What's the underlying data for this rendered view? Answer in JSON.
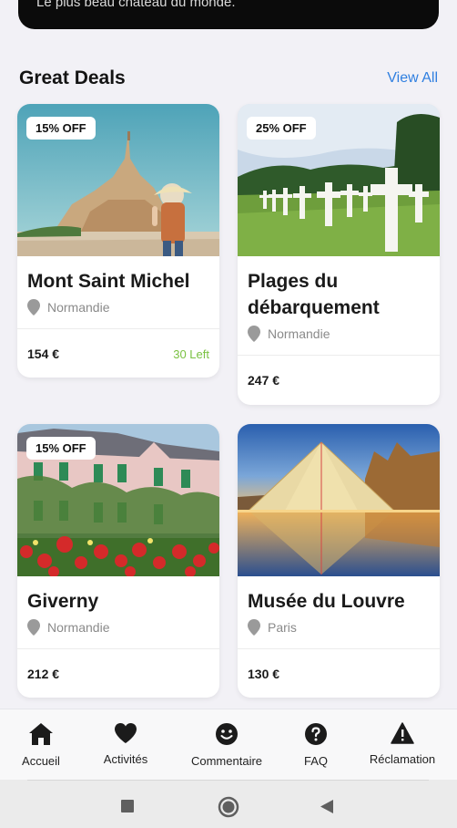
{
  "banner": {
    "text": "Le plus beau château du monde."
  },
  "section": {
    "title": "Great Deals",
    "view_all": "View All"
  },
  "deals": [
    {
      "badge": "15% OFF",
      "title": "Mont Saint Michel",
      "location": "Normandie",
      "price": "154 €",
      "left": "30 Left"
    },
    {
      "badge": "25% OFF",
      "title": "Plages du débarquement",
      "location": "Normandie",
      "price": "247 €"
    },
    {
      "badge": "15% OFF",
      "title": "Giverny",
      "location": "Normandie",
      "price": "212 €"
    },
    {
      "title": "Musée du Louvre",
      "location": "Paris",
      "price": "130 €"
    }
  ],
  "nav": [
    {
      "label": "Accueil",
      "icon": "home-icon"
    },
    {
      "label": "Activités",
      "icon": "heart-icon"
    },
    {
      "label": "Commentaire",
      "icon": "smiley-icon"
    },
    {
      "label": "FAQ",
      "icon": "question-icon"
    },
    {
      "label": "Réclamation",
      "icon": "warning-icon"
    }
  ],
  "system_nav": [
    "recents-icon",
    "home-circle-icon",
    "back-icon"
  ],
  "colors": {
    "accent": "#2f7fe0",
    "stock": "#7ac142",
    "text": "#1a1a1a",
    "muted": "#8a8a8a"
  }
}
